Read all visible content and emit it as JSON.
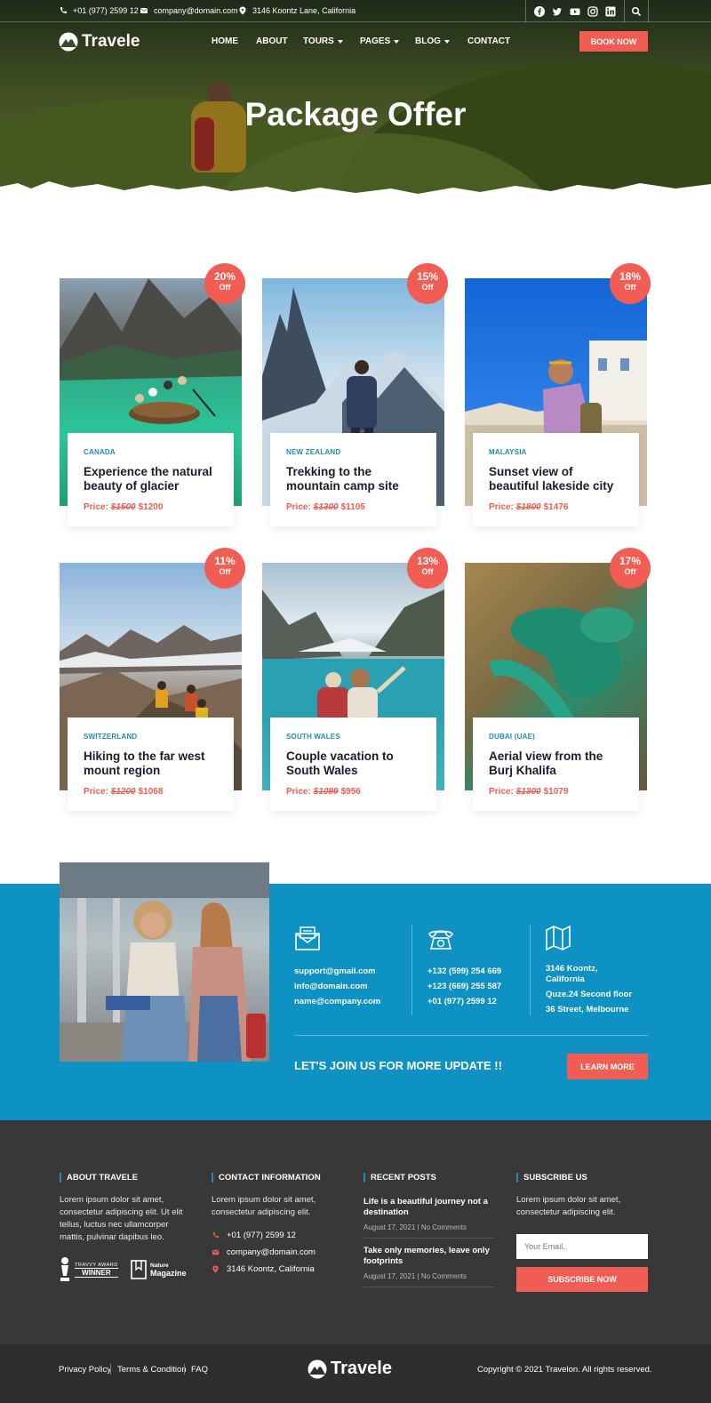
{
  "topbar": {
    "phone": "+01 (977) 2599 12",
    "email": "company@domain.com",
    "address": "3146 Koontz Lane, California",
    "social_icons": [
      "facebook-icon",
      "twitter-icon",
      "youtube-icon",
      "instagram-icon",
      "linkedin-icon"
    ]
  },
  "brand": {
    "name": "Travele"
  },
  "nav": {
    "items": [
      {
        "label": "HOME",
        "dropdown": false
      },
      {
        "label": "ABOUT",
        "dropdown": false
      },
      {
        "label": "TOURS",
        "dropdown": true
      },
      {
        "label": "PAGES",
        "dropdown": true
      },
      {
        "label": "BLOG",
        "dropdown": true
      },
      {
        "label": "CONTACT",
        "dropdown": false
      }
    ],
    "book_label": "BOOK NOW"
  },
  "hero": {
    "title": "Package Offer"
  },
  "packages": [
    {
      "discount": "20%",
      "off": "Off",
      "country": "CANADA",
      "title": "Experience the natural beauty of glacier",
      "price_label": "Price:",
      "old_price": "$1500",
      "new_price": "$1200"
    },
    {
      "discount": "15%",
      "off": "Off",
      "country": "NEW ZEALAND",
      "title": "Trekking to the mountain camp site",
      "price_label": "Price:",
      "old_price": "$1300",
      "new_price": "$1105"
    },
    {
      "discount": "18%",
      "off": "Off",
      "country": "MALAYSIA",
      "title": "Sunset view of beautiful lakeside city",
      "price_label": "Price:",
      "old_price": "$1800",
      "new_price": "$1476"
    },
    {
      "discount": "11%",
      "off": "Off",
      "country": "SWITZERLAND",
      "title": "Hiking to the far west mount region",
      "price_label": "Price:",
      "old_price": "$1200",
      "new_price": "$1068"
    },
    {
      "discount": "13%",
      "off": "Off",
      "country": "SOUTH WALES",
      "title": "Couple vacation to South Wales",
      "price_label": "Price:",
      "old_price": "$1099",
      "new_price": "$956"
    },
    {
      "discount": "17%",
      "off": "Off",
      "country": "DUBAI (UAE)",
      "title": "Aerial view from the Burj Khalifa",
      "price_label": "Price:",
      "old_price": "$1300",
      "new_price": "$1079"
    }
  ],
  "contact": {
    "emails": [
      "support@gmail.com",
      "info@domain.com",
      "name@company.com"
    ],
    "phones": [
      "+132 (599) 254 669",
      "+123 (669) 255 587",
      "+01 (977) 2599 12"
    ],
    "address": [
      "3146 Koontz,",
      "California",
      "Quze.24 Second floor",
      "36 Street, Melbourne"
    ],
    "join_text": "LET'S JOIN US FOR MORE UPDATE !!",
    "learn_label": "LEARN MORE"
  },
  "footer": {
    "about_title": "ABOUT TRAVELE",
    "about_text": "Lorem ipsum dolor sit amet, consectetur adipiscing elit. Ut elit tellus, luctus nec ullamcorper mattis, pulvinar dapibus leo.",
    "award1_top": "TRAVVY AWARD",
    "award1_main": "WINNER",
    "award2_top": "Nature",
    "award2_main": "Magazine",
    "contact_title": "CONTACT INFORMATION",
    "contact_text": "Lorem ipsum dolor sit amet, consectetur adipiscing elit.",
    "contact_phone": "+01 (977) 2599 12",
    "contact_email": "company@domain.com",
    "contact_address": "3146 Koontz, California",
    "posts_title": "RECENT POSTS",
    "posts": [
      {
        "title": "Life is a beautiful journey not a destination",
        "date": "August 17, 2021",
        "comments": "No Comments"
      },
      {
        "title": "Take only memories, leave only footprints",
        "date": "August 17, 2021",
        "comments": "No Comments"
      }
    ],
    "subscribe_title": "SUBSCRIBE US",
    "subscribe_text": "Lorem ipsum dolor sit amet, consectetur adipiscing elit.",
    "email_placeholder": "Your Email..",
    "subscribe_label": "SUBSCRIBE NOW"
  },
  "bottom": {
    "links": [
      "Privacy Policy",
      "Terms & Condition",
      "FAQ"
    ],
    "copyright": "Copyright © 2021 Travelon. All rights reserved."
  },
  "colors": {
    "accent": "#f15d52",
    "primary": "#1d8cbd",
    "band": "#0e91c3",
    "footer": "#383838"
  }
}
